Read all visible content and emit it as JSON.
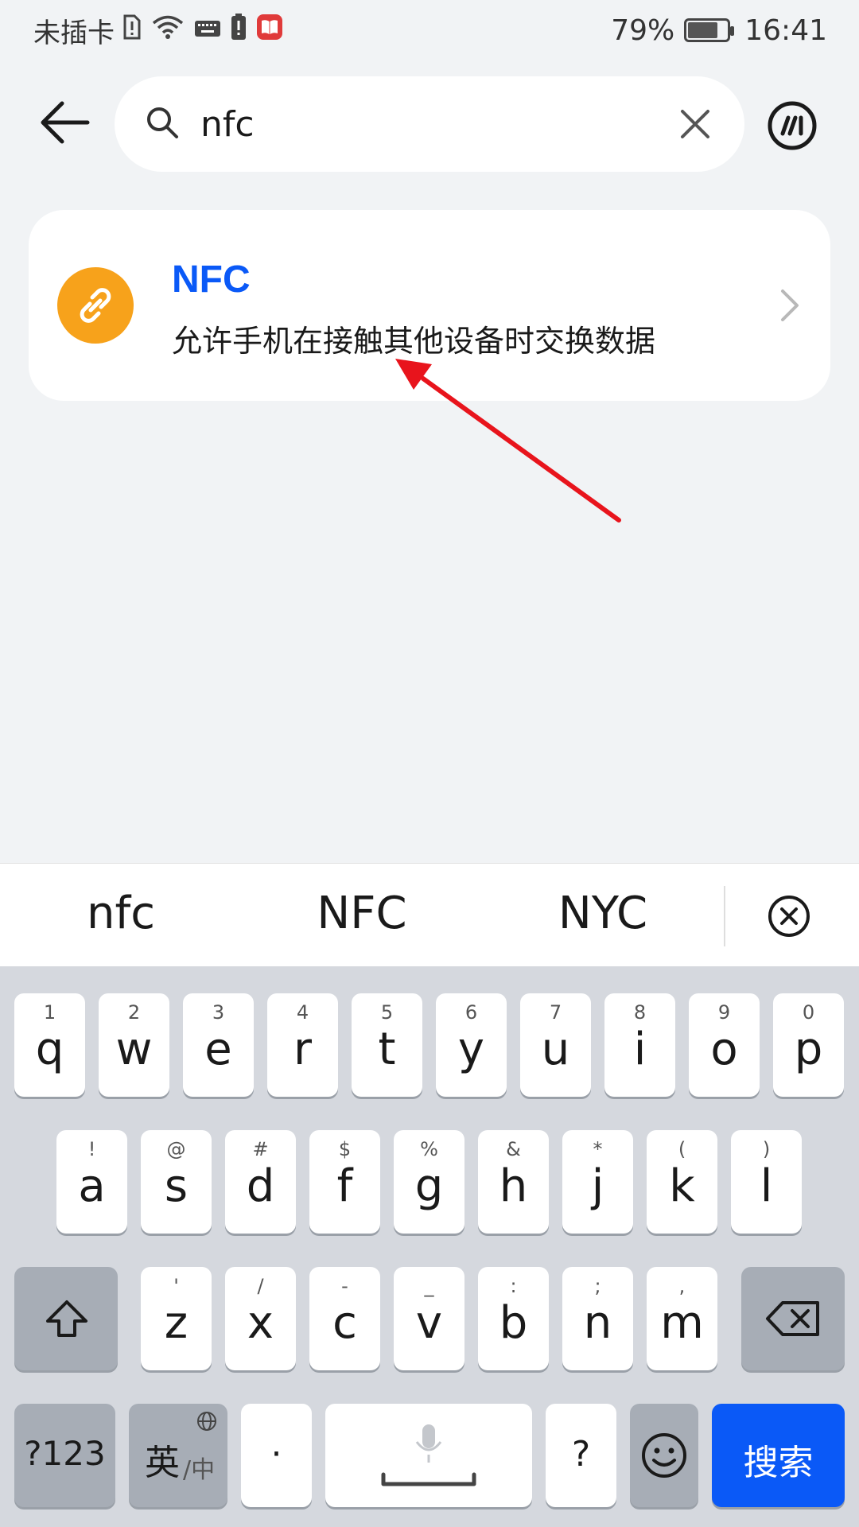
{
  "status_bar": {
    "carrier": "未插卡",
    "battery_percent": "79%",
    "battery_level": 0.79,
    "time": "16:41"
  },
  "search": {
    "query": "nfc"
  },
  "result": {
    "title": "NFC",
    "description": "允许手机在接触其他设备时交换数据"
  },
  "suggestions": [
    "nfc",
    "NFC",
    "NYC"
  ],
  "keyboard": {
    "row1": [
      {
        "num": "1",
        "ltr": "q"
      },
      {
        "num": "2",
        "ltr": "w"
      },
      {
        "num": "3",
        "ltr": "e"
      },
      {
        "num": "4",
        "ltr": "r"
      },
      {
        "num": "5",
        "ltr": "t"
      },
      {
        "num": "6",
        "ltr": "y"
      },
      {
        "num": "7",
        "ltr": "u"
      },
      {
        "num": "8",
        "ltr": "i"
      },
      {
        "num": "9",
        "ltr": "o"
      },
      {
        "num": "0",
        "ltr": "p"
      }
    ],
    "row2": [
      {
        "num": "!",
        "ltr": "a"
      },
      {
        "num": "@",
        "ltr": "s"
      },
      {
        "num": "#",
        "ltr": "d"
      },
      {
        "num": "$",
        "ltr": "f"
      },
      {
        "num": "%",
        "ltr": "g"
      },
      {
        "num": "&",
        "ltr": "h"
      },
      {
        "num": "*",
        "ltr": "j"
      },
      {
        "num": "(",
        "ltr": "k"
      },
      {
        "num": ")",
        "ltr": "l"
      }
    ],
    "row3": [
      {
        "num": "'",
        "ltr": "z"
      },
      {
        "num": "/",
        "ltr": "x"
      },
      {
        "num": "-",
        "ltr": "c"
      },
      {
        "num": "_",
        "ltr": "v"
      },
      {
        "num": ":",
        "ltr": "b"
      },
      {
        "num": ";",
        "ltr": "n"
      },
      {
        "num": ",",
        "ltr": "m"
      }
    ],
    "symbols_key": "?123",
    "lang_key_main": "英",
    "lang_key_sub": "/中",
    "dot_key": "·",
    "question_key": "?",
    "search_key": "搜索"
  },
  "colors": {
    "accent": "#0a59f7",
    "nfc_icon_bg": "#f7a21b",
    "annotation_arrow": "#e8141c"
  }
}
